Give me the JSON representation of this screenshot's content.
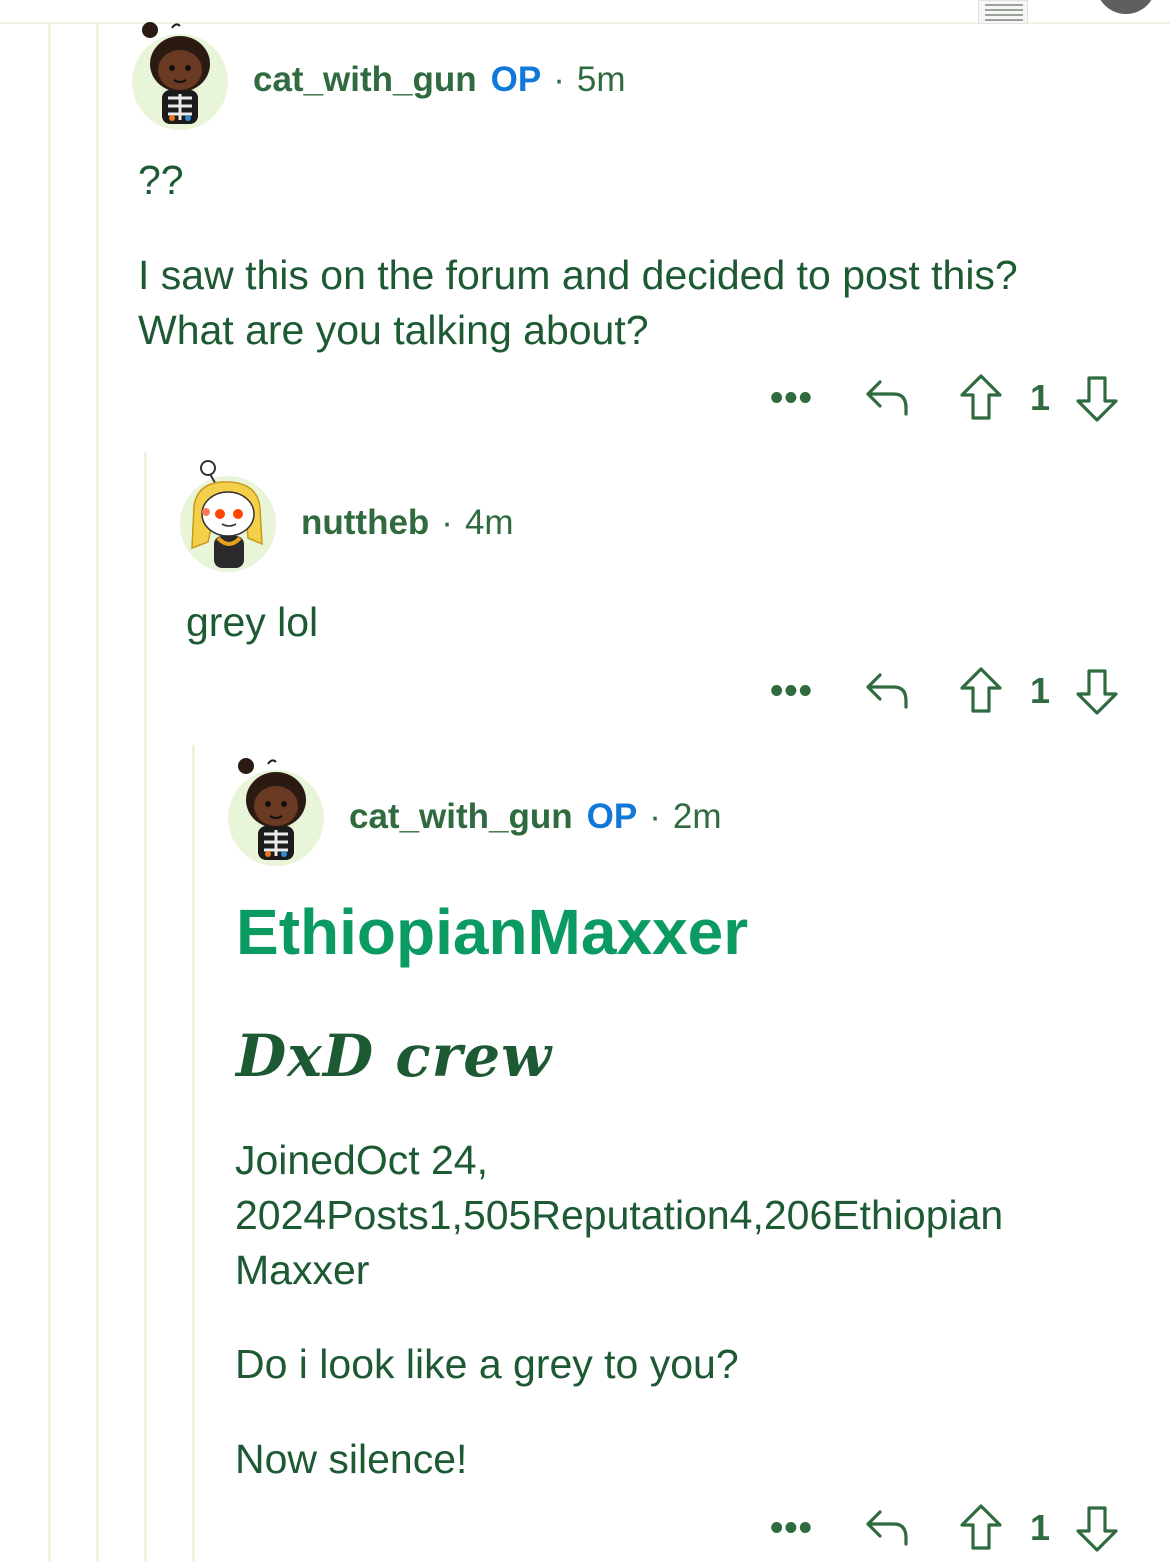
{
  "comments": [
    {
      "username": "cat_with_gun",
      "op_label": "OP",
      "separator": "·",
      "time": "5m",
      "body": [
        "??",
        "I saw this on the forum and decided to post this? What are you talking about?"
      ],
      "more": "•••",
      "score": "1"
    },
    {
      "username": "nuttheb",
      "separator": "·",
      "time": "4m",
      "body": [
        "grey lol"
      ],
      "more": "•••",
      "score": "1"
    },
    {
      "username": "cat_with_gun",
      "op_label": "OP",
      "separator": "·",
      "time": "2m",
      "flair_title": "EthiopianMaxxer",
      "crew_text": "DxD crew",
      "profile_line": "JoinedOct 24, 2024Posts1,505Reputation4,206Ethiopian Maxxer",
      "body": [
        "Do i look like a grey to you?",
        "Now silence!"
      ],
      "more": "•••",
      "score": "1"
    }
  ],
  "icons": {
    "reply": "reply-arrow-icon",
    "upvote": "upvote-arrow-icon",
    "downvote": "downvote-arrow-icon"
  },
  "colors": {
    "text": "#1d5a33",
    "username": "#2f6b3f",
    "op": "#0f78d8",
    "flair": "#0a9a62",
    "thread_line": "#edf3dc"
  }
}
